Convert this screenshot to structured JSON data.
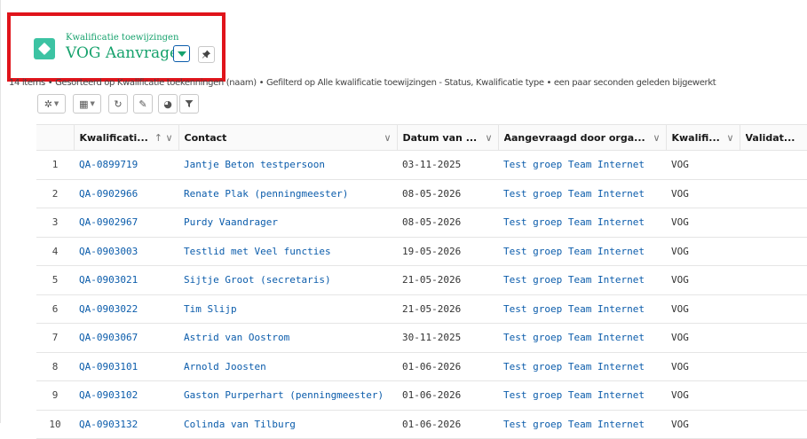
{
  "header": {
    "object_label": "Kwalificatie toewijzingen",
    "list_title": "VOG Aanvragen",
    "pin_icon": "pin-icon"
  },
  "info_line": "14 items • Gesorteerd op Kwalificatie toekenningen (naam) • Gefilterd op Alle kwalificatie toewijzingen - Status, Kwalificatie type • een paar seconden geleden bijgewerkt",
  "toolbar": {
    "buttons": [
      "gear-icon",
      "table-view-icon",
      "refresh-icon",
      "edit-icon",
      "chart-icon",
      "filter-icon"
    ]
  },
  "table": {
    "columns": [
      {
        "label": "Kwalificati...",
        "sort": "↑"
      },
      {
        "label": "Contact"
      },
      {
        "label": "Datum van ..."
      },
      {
        "label": "Aangevraagd door orga..."
      },
      {
        "label": "Kwalifi..."
      },
      {
        "label": "Validat..."
      }
    ],
    "rows": [
      {
        "n": "1",
        "id": "QA-0899719",
        "contact": "Jantje Beton testpersoon",
        "date": "03-11-2025",
        "org": "Test groep Team Internet",
        "type": "VOG",
        "validation": ""
      },
      {
        "n": "2",
        "id": "QA-0902966",
        "contact": "Renate Plak (penningmeester)",
        "date": "08-05-2026",
        "org": "Test groep Team Internet",
        "type": "VOG",
        "validation": ""
      },
      {
        "n": "3",
        "id": "QA-0902967",
        "contact": "Purdy Vaandrager",
        "date": "08-05-2026",
        "org": "Test groep Team Internet",
        "type": "VOG",
        "validation": ""
      },
      {
        "n": "4",
        "id": "QA-0903003",
        "contact": "Testlid met Veel functies",
        "date": "19-05-2026",
        "org": "Test groep Team Internet",
        "type": "VOG",
        "validation": ""
      },
      {
        "n": "5",
        "id": "QA-0903021",
        "contact": "Sijtje Groot (secretaris)",
        "date": "21-05-2026",
        "org": "Test groep Team Internet",
        "type": "VOG",
        "validation": ""
      },
      {
        "n": "6",
        "id": "QA-0903022",
        "contact": "Tim Slijp",
        "date": "21-05-2026",
        "org": "Test groep Team Internet",
        "type": "VOG",
        "validation": ""
      },
      {
        "n": "7",
        "id": "QA-0903067",
        "contact": "Astrid van Oostrom",
        "date": "30-11-2025",
        "org": "Test groep Team Internet",
        "type": "VOG",
        "validation": ""
      },
      {
        "n": "8",
        "id": "QA-0903101",
        "contact": "Arnold Joosten",
        "date": "01-06-2026",
        "org": "Test groep Team Internet",
        "type": "VOG",
        "validation": ""
      },
      {
        "n": "9",
        "id": "QA-0903102",
        "contact": "Gaston Purperhart (penningmeester)",
        "date": "01-06-2026",
        "org": "Test groep Team Internet",
        "type": "VOG",
        "validation": ""
      },
      {
        "n": "10",
        "id": "QA-0903132",
        "contact": "Colinda van Tilburg",
        "date": "01-06-2026",
        "org": "Test groep Team Internet",
        "type": "VOG",
        "validation": ""
      }
    ]
  },
  "colors": {
    "accent_green": "#17a26d",
    "icon_teal": "#3cc3a3",
    "link_blue": "#0b5cab",
    "highlight_red": "#e0141b"
  }
}
